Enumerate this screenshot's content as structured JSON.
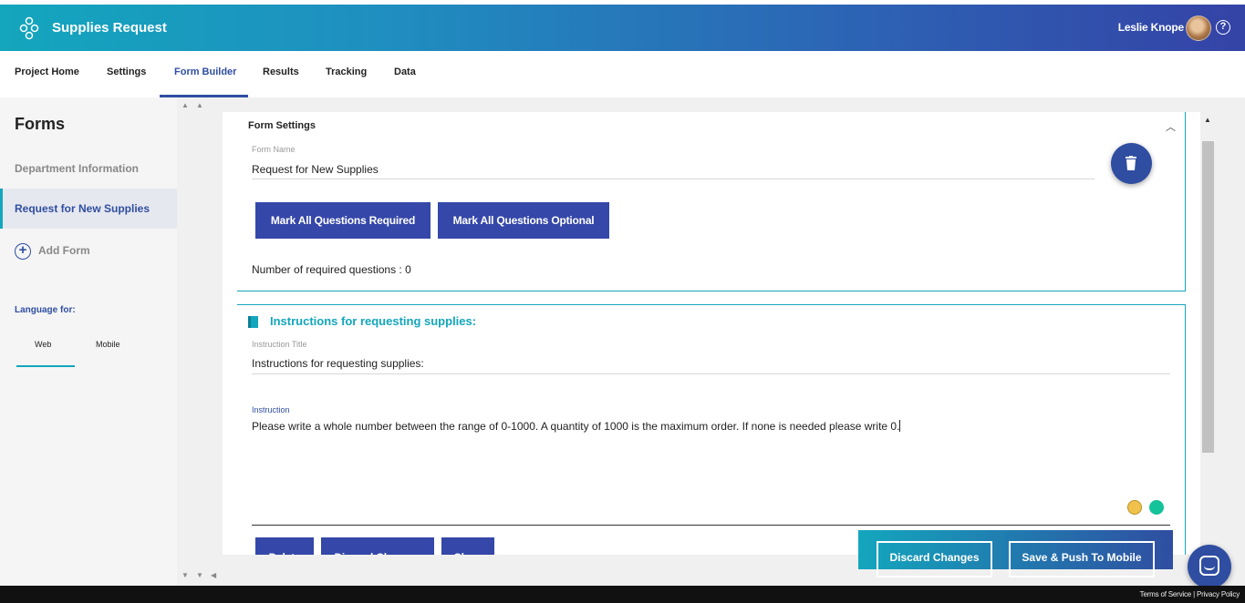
{
  "app": {
    "title": "Supplies Request",
    "user_name": "Leslie Knope",
    "help_icon": "?"
  },
  "nav": {
    "tabs": [
      "Project Home",
      "Settings",
      "Form Builder",
      "Results",
      "Tracking",
      "Data"
    ],
    "active": "Form Builder"
  },
  "sidebar": {
    "title": "Forms",
    "forms": [
      "Department Information",
      "Request for New Supplies"
    ],
    "active_form": "Request for New Supplies",
    "add_form_label": "Add Form",
    "language_label": "Language for:",
    "language_tabs": [
      "Web",
      "Mobile"
    ],
    "active_language": "Web"
  },
  "form_settings": {
    "title": "Form Settings",
    "form_name_label": "Form Name",
    "form_name_value": "Request for New Supplies",
    "mark_required_label": "Mark All Questions Required",
    "mark_optional_label": "Mark All Questions Optional",
    "required_count_text": "Number of required questions : 0"
  },
  "instruction_card": {
    "heading": "Instructions for requesting supplies:",
    "title_label": "Instruction Title",
    "title_value": "Instructions for requesting supplies:",
    "instruction_label": "Instruction",
    "instruction_value": "Please write a whole number between the range of 0-1000. A quantity of 1000 is the maximum order. If none is needed please write 0.",
    "buttons": [
      "Delete",
      "Discard Changes",
      "Close"
    ]
  },
  "save_bar": {
    "discard_label": "Discard Changes",
    "save_label": "Save & Push To Mobile"
  },
  "footer": {
    "terms": "Terms of Service",
    "separator": "|",
    "privacy": "Privacy Policy"
  },
  "colors": {
    "brand_blue": "#2f4ea1",
    "button_blue": "#3547a8",
    "teal": "#13a6bd",
    "footer_bg": "#111111"
  }
}
